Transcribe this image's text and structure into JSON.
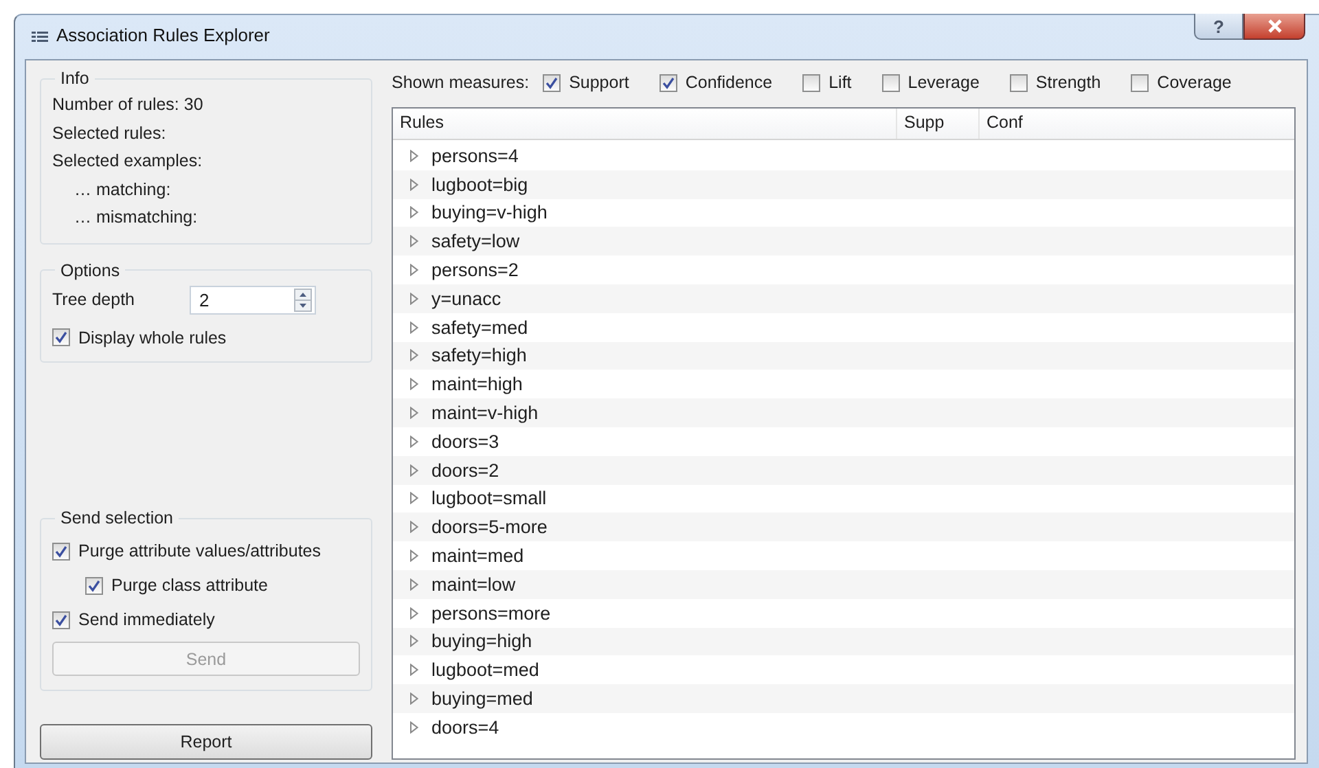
{
  "window": {
    "title": "Association Rules Explorer",
    "help_button": "?"
  },
  "info": {
    "title": "Info",
    "lines": [
      {
        "text": "Number of rules: 30",
        "indented": false
      },
      {
        "text": "Selected rules:",
        "indented": false
      },
      {
        "text": "Selected examples:",
        "indented": false
      },
      {
        "text": "… matching:",
        "indented": true
      },
      {
        "text": "… mismatching:",
        "indented": true
      }
    ]
  },
  "options": {
    "title": "Options",
    "tree_depth": {
      "label": "Tree depth",
      "value": "2"
    },
    "display_whole_rules": {
      "label": "Display whole rules",
      "checked": true
    }
  },
  "send_selection": {
    "title": "Send selection",
    "checkboxes": [
      {
        "label": "Purge attribute values/attributes",
        "checked": true,
        "indented": false
      },
      {
        "label": "Purge class attribute",
        "checked": true,
        "indented": true
      },
      {
        "label": "Send immediately",
        "checked": true,
        "indented": false
      }
    ],
    "send_button": {
      "label": "Send",
      "disabled": true
    }
  },
  "report_button": "Report",
  "measures": {
    "label": "Shown measures:",
    "items": [
      {
        "label": "Support",
        "checked": true
      },
      {
        "label": "Confidence",
        "checked": true
      },
      {
        "label": "Lift",
        "checked": false
      },
      {
        "label": "Leverage",
        "checked": false
      },
      {
        "label": "Strength",
        "checked": false
      },
      {
        "label": "Coverage",
        "checked": false
      }
    ]
  },
  "rules_tree": {
    "columns": [
      "Rules",
      "Supp",
      "Conf"
    ],
    "rows": [
      {
        "text": "persons=4",
        "expanded": false
      },
      {
        "text": "lugboot=big",
        "expanded": false
      },
      {
        "text": "buying=v-high",
        "expanded": false
      },
      {
        "text": "safety=low",
        "expanded": false
      },
      {
        "text": "persons=2",
        "expanded": false
      },
      {
        "text": "y=unacc",
        "expanded": false
      },
      {
        "text": "safety=med",
        "expanded": false
      },
      {
        "text": "safety=high",
        "expanded": false
      },
      {
        "text": "maint=high",
        "expanded": false
      },
      {
        "text": "maint=v-high",
        "expanded": false
      },
      {
        "text": "doors=3",
        "expanded": false
      },
      {
        "text": "doors=2",
        "expanded": false
      },
      {
        "text": "lugboot=small",
        "expanded": false
      },
      {
        "text": "doors=5-more",
        "expanded": false
      },
      {
        "text": "maint=med",
        "expanded": false
      },
      {
        "text": "maint=low",
        "expanded": false
      },
      {
        "text": "persons=more",
        "expanded": false
      },
      {
        "text": "buying=high",
        "expanded": false
      },
      {
        "text": "lugboot=med",
        "expanded": false
      },
      {
        "text": "buying=med",
        "expanded": false
      },
      {
        "text": "doors=4",
        "expanded": false
      }
    ]
  }
}
